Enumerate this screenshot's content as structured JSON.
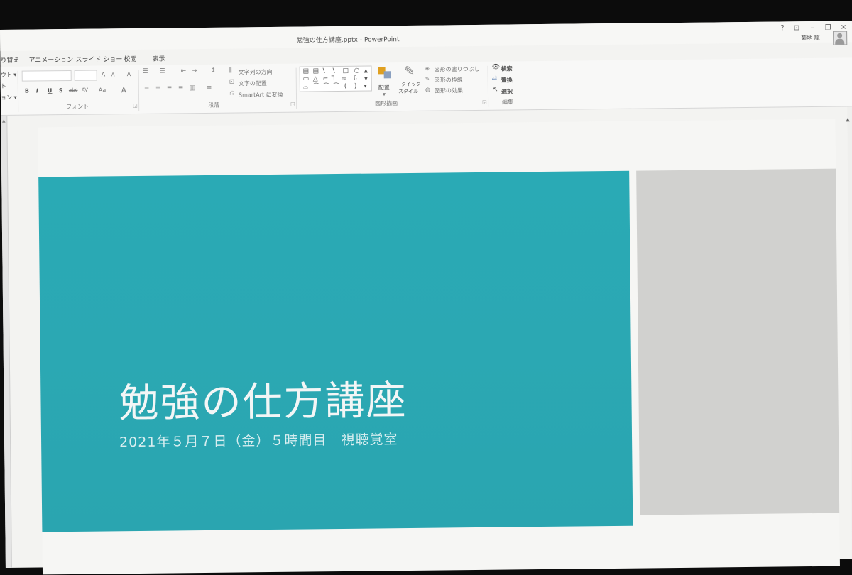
{
  "window": {
    "title": "勉強の仕方講座.pptx - PowerPoint",
    "help": "?",
    "ribbon_options": "⊡",
    "minimize": "–",
    "restore": "❐",
    "close": "✕",
    "user_name": "菊地 龍 -"
  },
  "tabs": {
    "transitions_partial": "り替え",
    "animations": "アニメーション",
    "slideshow": "スライド ショー",
    "review": "校閲",
    "view": "表示"
  },
  "ribbon": {
    "slides_partial": {
      "layout": "ウト ▾",
      "reset": "ト",
      "section": "ョン ▾"
    },
    "font": {
      "group_label": "フォント",
      "grow": "A",
      "shrink": "A",
      "clear": "A",
      "bold": "B",
      "italic": "I",
      "underline": "U",
      "shadow": "S",
      "strike": "abc",
      "spacing": "AV",
      "case": "Aa",
      "color": "A"
    },
    "paragraph": {
      "group_label": "段落",
      "text_direction": "文字列の方向",
      "align_text": "文字の配置",
      "smartart": "SmartArt に変換"
    },
    "drawing": {
      "group_label": "図形描画",
      "shapes": [
        "▤",
        "▤",
        "\\",
        "\\",
        "□",
        "○",
        "▭",
        "△",
        "⌐",
        "⅂",
        "⇨",
        "⇩",
        "⌓",
        "⌒",
        "⌒",
        "⌒",
        "(",
        ")"
      ],
      "arrange": "配置",
      "quick_styles_line1": "クイック",
      "quick_styles_line2": "スタイル",
      "shape_fill": "図形の塗りつぶし",
      "shape_outline": "図形の枠線",
      "shape_effects": "図形の効果"
    },
    "editing": {
      "group_label": "編集",
      "find": "検索",
      "replace": "置換",
      "select": "選択"
    }
  },
  "slide": {
    "title": "勉強の仕方講座",
    "subtitle": "2021年５月７日（金）５時間目　視聴覚室"
  },
  "colors": {
    "teal": "#2aa8b3",
    "grey_panel": "#d1d1cf"
  }
}
